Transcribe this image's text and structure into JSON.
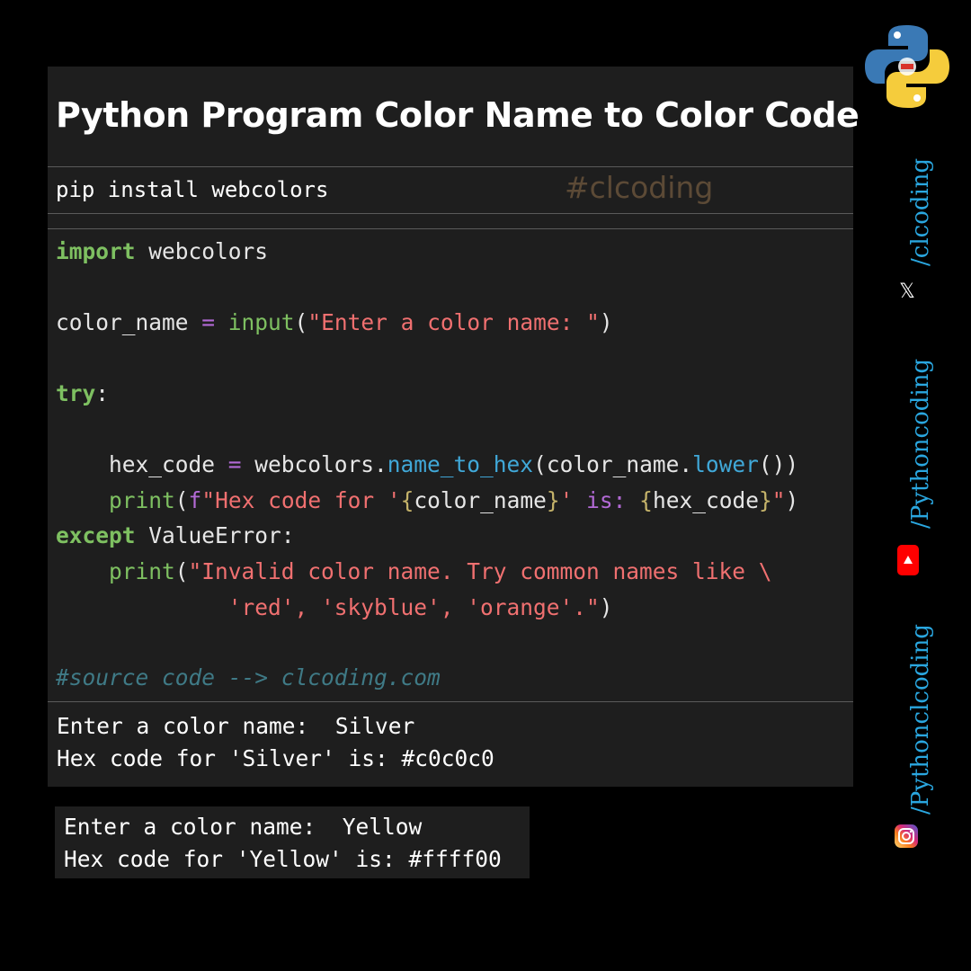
{
  "title": "Python Program Color Name to Color Code",
  "install": {
    "command": "pip install webcolors",
    "hashtag": "#clcoding"
  },
  "code": {
    "import_kw": "import",
    "import_mod": " webcolors",
    "l2_var": "color_name ",
    "l2_eq": "=",
    "l2_input": " input",
    "l2_open": "(",
    "l2_str": "\"Enter a color name: \"",
    "l2_close": ")",
    "try_kw": "try",
    "try_colon": ":",
    "l4_var": "    hex_code ",
    "l4_eq": "=",
    "l4_mod": " webcolors.",
    "l4_meth": "name_to_hex",
    "l4_arg": "(color_name.",
    "l4_meth2": "lower",
    "l4_end": "())",
    "l5_indent": "    ",
    "l5_print": "print",
    "l5_open": "(",
    "l5_f": "f",
    "l5_s1": "\"Hex code for '",
    "l5_b1": "{",
    "l5_v1": "color_name",
    "l5_b2": "}",
    "l5_s2": "' ",
    "l5_is": "is:",
    "l5_sp": " ",
    "l5_b3": "{",
    "l5_v2": "hex_code",
    "l5_b4": "}",
    "l5_q": "\"",
    "l5_close": ")",
    "except_kw": "except",
    "except_rest": " ValueError:",
    "l7_indent": "    ",
    "l7_print": "print",
    "l7_open": "(",
    "l7_str": "\"Invalid color name. Try common names like \\",
    "l8_indent": "             ",
    "l8_str": "'red', 'skyblue', 'orange'.\"",
    "l8_close": ")",
    "comment": "#source code --> clcoding.com"
  },
  "output1": {
    "line1": "Enter a color name:  Silver",
    "line2": "Hex code for 'Silver' is: #c0c0c0"
  },
  "output2": {
    "line1": "Enter a color name:  Yellow",
    "line2": "Hex code for 'Yellow' is: #ffff00"
  },
  "social": {
    "x_handle": "/clcoding",
    "x_icon": "x-logo-icon",
    "youtube_handle": "/Pythoncoding",
    "youtube_icon": "youtube-icon",
    "instagram_handle": "/Pythonclcoding",
    "instagram_icon": "instagram-icon",
    "x_glyph": "𝕏"
  },
  "colors": {
    "background": "#000000",
    "panel": "#1e1e1e",
    "keyword": "#7ec061",
    "operator": "#b36ad6",
    "string": "#f07070",
    "method": "#40a8d8",
    "comment": "#3f7a86",
    "social": "#2aa7e0"
  }
}
